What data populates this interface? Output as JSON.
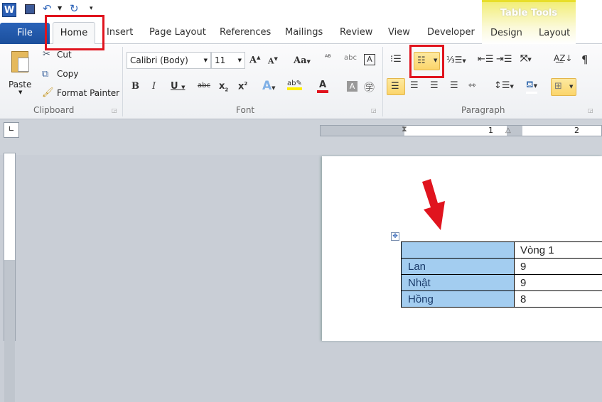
{
  "quick_access": {
    "icons": [
      "word-logo",
      "save-icon",
      "undo-icon",
      "undo-dropdown",
      "redo-icon",
      "customize-icon"
    ]
  },
  "tabs": {
    "file": "File",
    "home": "Home",
    "items": [
      "Insert",
      "Page Layout",
      "References",
      "Mailings",
      "Review",
      "View",
      "Developer"
    ],
    "context_header": "Table Tools",
    "context_tabs": [
      "Design",
      "Layout"
    ]
  },
  "clipboard": {
    "paste": "Paste",
    "cut": "Cut",
    "copy": "Copy",
    "format_painter": "Format Painter",
    "label": "Clipboard"
  },
  "font": {
    "family": "Calibri (Body)",
    "size": "11",
    "label": "Font"
  },
  "paragraph": {
    "label": "Paragraph"
  },
  "table": {
    "rows": [
      [
        "",
        "Vòng 1"
      ],
      [
        "Lan",
        "9"
      ],
      [
        "Nhật",
        "9"
      ],
      [
        "Hồng",
        "8"
      ]
    ]
  },
  "ruler": {
    "labels": [
      "1",
      "1",
      "2"
    ]
  },
  "colors": {
    "highlight": "#a3cdf0",
    "annotation": "#e0141e",
    "file_tab": "#1b4f9c"
  }
}
